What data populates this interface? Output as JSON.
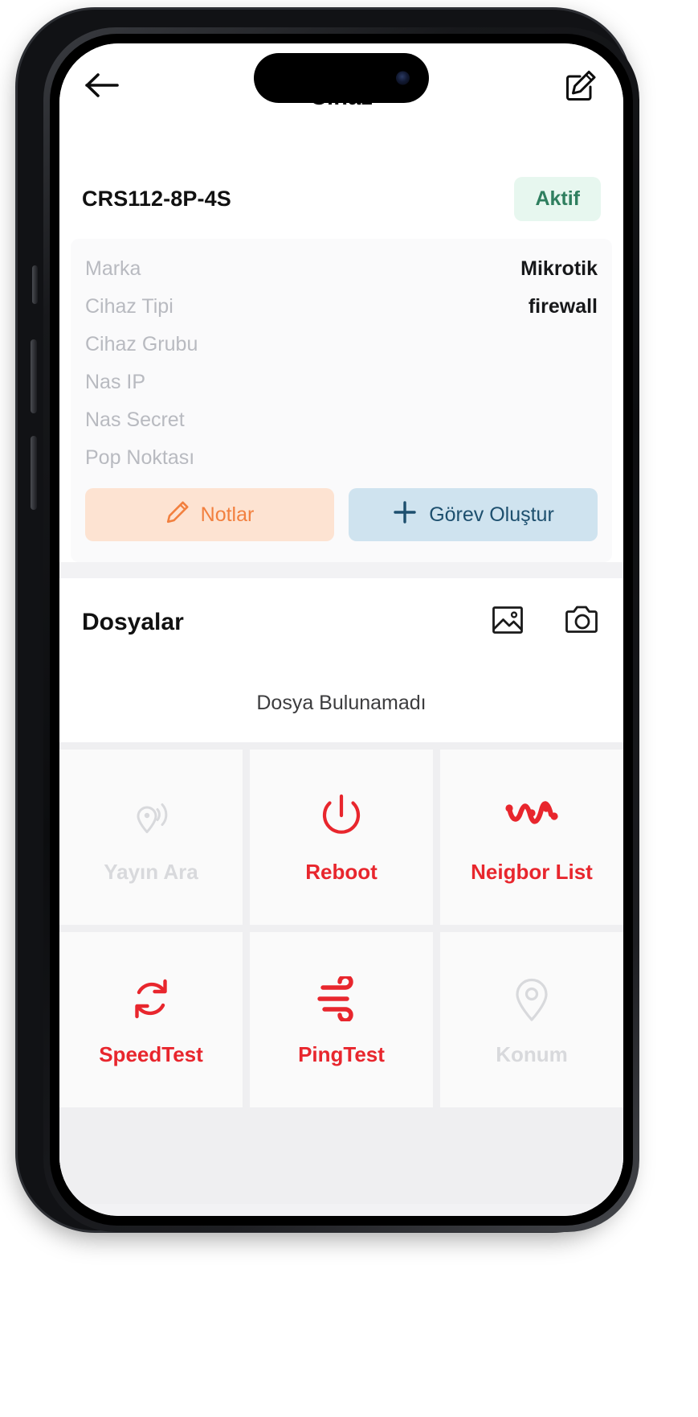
{
  "header": {
    "title": "Cihaz",
    "back_icon": "arrow-left-icon",
    "edit_icon": "edit-square-pencil-icon"
  },
  "device_card": {
    "name": "CRS112-8P-4S",
    "status": "Aktif",
    "status_bg": "#e7f7ef",
    "status_color": "#2f7f5f",
    "properties": [
      {
        "label": "Marka",
        "value": "Mikrotik"
      },
      {
        "label": "Cihaz Tipi",
        "value": "firewall"
      },
      {
        "label": "Cihaz Grubu",
        "value": ""
      },
      {
        "label": "Nas IP",
        "value": ""
      },
      {
        "label": "Nas Secret",
        "value": ""
      },
      {
        "label": "Pop Noktası",
        "value": ""
      }
    ],
    "actions": {
      "notes_label": "Notlar",
      "notes_icon": "pencil-icon",
      "notes_bg": "#fde3d2",
      "notes_color": "#f2803f",
      "task_label": "Görev Oluştur",
      "task_icon": "plus-icon",
      "task_bg": "#cfe3ef",
      "task_color": "#1d4f6e"
    }
  },
  "files": {
    "title": "Dosyalar",
    "gallery_icon": "image-gallery-icon",
    "camera_icon": "camera-icon",
    "empty_text": "Dosya Bulunamadı"
  },
  "tiles": [
    {
      "label": "Yayın Ara",
      "icon": "broadcast-pin-icon",
      "state": "disabled",
      "color": "#d8d9dc"
    },
    {
      "label": "Reboot",
      "icon": "power-icon",
      "state": "active",
      "color": "#e8262d"
    },
    {
      "label": "Neigbor List",
      "icon": "network-nodes-icon",
      "state": "active",
      "color": "#e8262d"
    },
    {
      "label": "SpeedTest",
      "icon": "refresh-sync-icon",
      "state": "active",
      "color": "#e8262d"
    },
    {
      "label": "PingTest",
      "icon": "wind-waves-icon",
      "state": "active",
      "color": "#e8262d"
    },
    {
      "label": "Konum",
      "icon": "location-pin-icon",
      "state": "disabled",
      "color": "#d8d9dc"
    }
  ]
}
